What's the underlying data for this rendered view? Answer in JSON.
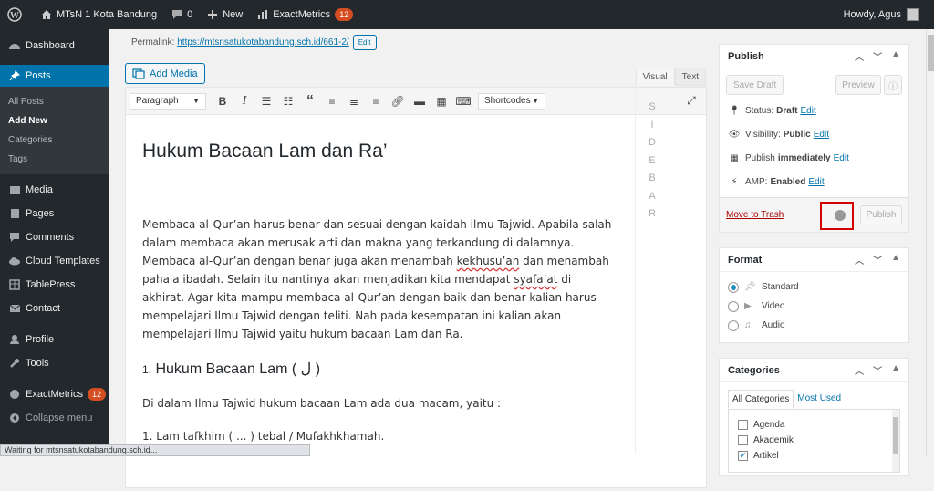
{
  "adminbar": {
    "site_name": "MTsN 1 Kota Bandung",
    "comments_count": "0",
    "new_label": "New",
    "exactmetrics_label": "ExactMetrics",
    "exactmetrics_badge": "12",
    "greeting": "Howdy, Agus"
  },
  "menu": {
    "dashboard": "Dashboard",
    "posts": "Posts",
    "posts_sub": [
      "All Posts",
      "Add New",
      "Categories",
      "Tags"
    ],
    "media": "Media",
    "pages": "Pages",
    "comments": "Comments",
    "cloud_templates": "Cloud Templates",
    "tablepress": "TablePress",
    "contact": "Contact",
    "profile": "Profile",
    "tools": "Tools",
    "exactmetrics": "ExactMetrics",
    "exactmetrics_badge": "12",
    "collapse": "Collapse menu"
  },
  "editor": {
    "permalink_label": "Permalink:",
    "permalink_url": "https://mtsnsatukotabandung.sch.id/661-2/",
    "permalink_edit": "Edit",
    "add_media": "Add Media",
    "tab_visual": "Visual",
    "tab_text": "Text",
    "format_select": "Paragraph",
    "shortcodes_select": "Shortcodes",
    "sidebar_letters": [
      "S",
      "I",
      "D",
      "E",
      "B",
      "A",
      "R"
    ],
    "title": "Hukum Bacaan Lam dan Ra’",
    "para1_a": "Membaca al-Qur’an harus benar dan sesuai dengan kaidah ilmu Tajwid. Apabila salah dalam membaca akan merusak arti dan makna yang terkandung di dalamnya. Membaca al-Qur’an dengan benar juga akan menambah ",
    "para1_b": "kekhusu’an",
    "para1_c": " dan menambah pahala ibadah. Selain itu nantinya akan menjadikan kita mendapat ",
    "para1_d": "syafa’at",
    "para1_e": " di akhirat. Agar kita mampu membaca al-Qur’an dengan baik dan benar kalian harus mempelajari Ilmu Tajwid dengan teliti. Nah pada kesempatan ini kalian akan mempelajari Ilmu Tajwid yaitu hukum bacaan Lam dan Ra.",
    "h2_num": "1.",
    "h2_text": "Hukum Bacaan Lam ( ل )",
    "para2": " Di dalam Ilmu Tajwid hukum bacaan Lam  ada dua macam, yaitu :",
    "para3": "1. Lam tafkhim ( ... ) tebal / Mufakhkhamah."
  },
  "publish": {
    "title": "Publish",
    "save_draft": "Save Draft",
    "preview": "Preview",
    "status_label": "Status:",
    "status_value": "Draft",
    "visibility_label": "Visibility:",
    "visibility_value": "Public",
    "publish_label": "Publish",
    "publish_value": "immediately",
    "amp_label": "AMP:",
    "amp_value": "Enabled",
    "edit": "Edit",
    "move_to_trash": "Move to Trash",
    "publish_button": "Publish"
  },
  "format": {
    "title": "Format",
    "options": [
      "Standard",
      "Video",
      "Audio"
    ],
    "selected": "Standard"
  },
  "categories": {
    "title": "Categories",
    "tab_all": "All Categories",
    "tab_most": "Most Used",
    "items": [
      "Agenda",
      "Akademik",
      "Artikel"
    ]
  },
  "status_bar": "Waiting for mtsnsatukotabandung.sch.id..."
}
